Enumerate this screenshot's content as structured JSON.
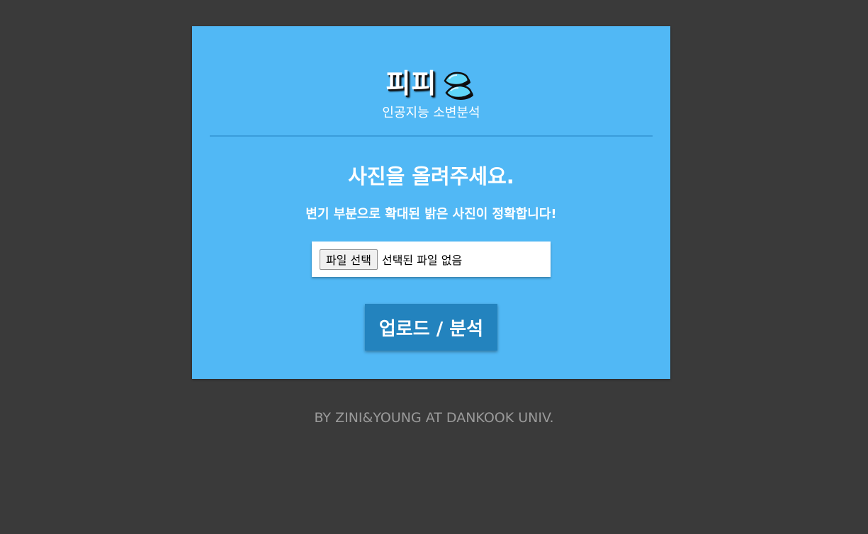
{
  "header": {
    "title": "피피",
    "subtitle": "인공지능 소변분석",
    "logo_icon": "water-drops-icon"
  },
  "main": {
    "heading": "사진을 올려주세요.",
    "hint": "변기 부분으로 확대된 밝은 사진이 정확합니다!",
    "file_input": {
      "button_label": "파일 선택",
      "status": "선택된 파일 없음"
    },
    "upload_label": "업로드 / 분석"
  },
  "footer": {
    "credit": "BY ZINI&YOUNG AT DANKOOK UNIV."
  },
  "colors": {
    "background": "#3a3a3a",
    "card": "#51b8f5",
    "divider": "#3a9ddb",
    "button": "#2383be",
    "footer_text": "#9a9a9a"
  }
}
